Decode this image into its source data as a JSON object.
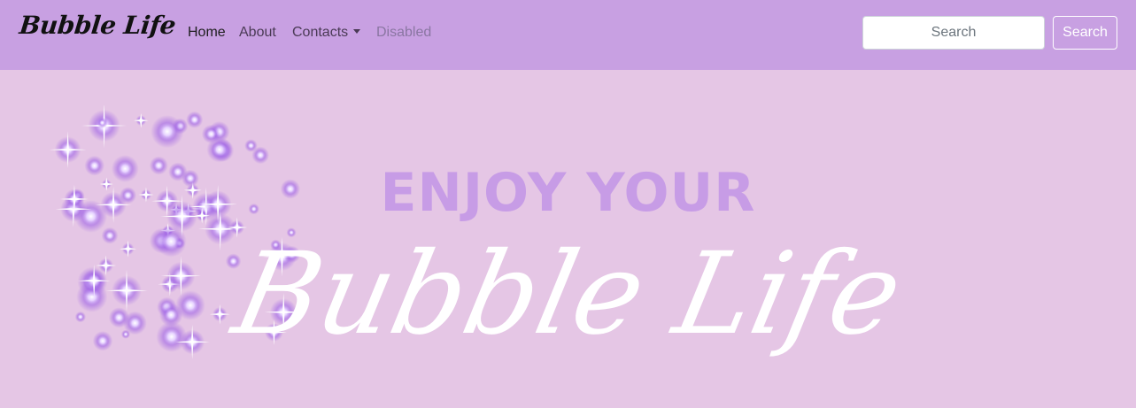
{
  "navbar": {
    "brand": "Bubble Life",
    "links": [
      {
        "label": "Home",
        "state": "active"
      },
      {
        "label": "About",
        "state": "normal"
      },
      {
        "label": "Contacts",
        "state": "dropdown"
      },
      {
        "label": "Disabled",
        "state": "disabled"
      }
    ],
    "search": {
      "placeholder": "Search",
      "button_label": "Search"
    }
  },
  "hero": {
    "headline": "ENJOY YOUR",
    "script_title": "Bubble Life"
  },
  "colors": {
    "navbar_bg": "#c8a0e2",
    "hero_bg": "#e5c6e5",
    "headline": "#c79ce6",
    "script": "#ffffff",
    "sparkle_glow": "#9b5de5"
  }
}
